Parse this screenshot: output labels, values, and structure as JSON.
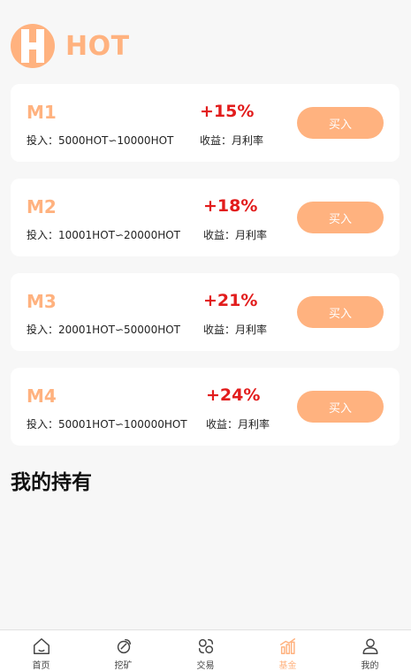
{
  "header": {
    "logo_letter": "H",
    "logo_text": "HOT"
  },
  "plans": [
    {
      "name": "M1",
      "rate": "+15%",
      "invest": "投入：5000HOT∽10000HOT",
      "income": "收益：月利率",
      "buy_label": "买入"
    },
    {
      "name": "M2",
      "rate": "+18%",
      "invest": "投入：10001HOT∽20000HOT",
      "income": "收益：月利率",
      "buy_label": "买入"
    },
    {
      "name": "M3",
      "rate": "+21%",
      "invest": "投入：20001HOT∽50000HOT",
      "income": "收益：月利率",
      "buy_label": "买入"
    },
    {
      "name": "M4",
      "rate": "+24%",
      "invest": "投入：50001HOT∽100000HOT",
      "income": "收益：月利率",
      "buy_label": "买入"
    }
  ],
  "holdings": {
    "title": "我的持有"
  },
  "tabbar": {
    "items": [
      {
        "label": "首页",
        "icon": "home-icon",
        "active": false
      },
      {
        "label": "挖矿",
        "icon": "pickaxe-icon",
        "active": false
      },
      {
        "label": "交易",
        "icon": "exchange-icon",
        "active": false
      },
      {
        "label": "基金",
        "icon": "chart-icon",
        "active": true
      },
      {
        "label": "我的",
        "icon": "user-icon",
        "active": false
      }
    ]
  },
  "colors": {
    "accent": "#ffb27f",
    "rate_red": "#e21c1c",
    "background": "#f7f7f7"
  }
}
